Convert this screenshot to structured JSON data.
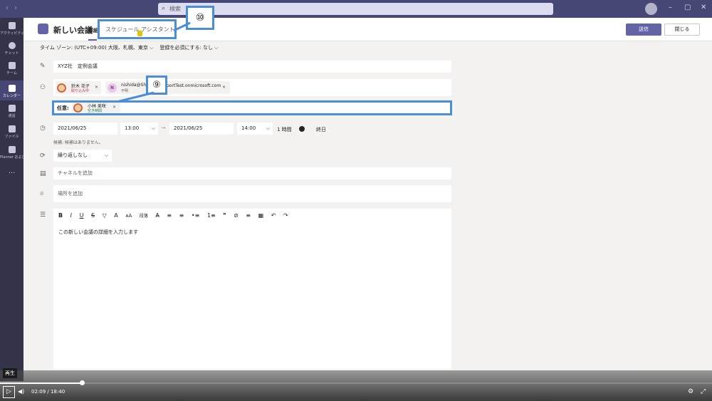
{
  "search": {
    "placeholder": "検索"
  },
  "rail": [
    {
      "label": "アクティビティ",
      "icon": "bell-icon"
    },
    {
      "label": "チャット",
      "icon": "chat-icon"
    },
    {
      "label": "チーム",
      "icon": "teams-icon"
    },
    {
      "label": "カレンダー",
      "icon": "calendar-icon"
    },
    {
      "label": "通話",
      "icon": "phone-icon"
    },
    {
      "label": "ファイル",
      "icon": "file-icon"
    },
    {
      "label": "Planner および...",
      "icon": "planner-icon"
    },
    {
      "label": "...",
      "icon": "more-icon"
    }
  ],
  "header": {
    "title": "新しい会議",
    "tab_details": "詳細",
    "tab_scheduling": "スケジュール アシスタント",
    "callout_10": "⑩",
    "send": "送信",
    "close": "閉じる"
  },
  "options": {
    "timezone": "タイム ゾーン: (UTC+09:00) 大阪、札幌、東京",
    "registration": "登録を必須にする: なし"
  },
  "form": {
    "title_value": "XYZ社　定例会議",
    "attendees": [
      {
        "name": "鈴木 花子",
        "status": "取り込み中"
      },
      {
        "initial": "N",
        "name": "nishida@Sh",
        "status": "不明",
        "suffix": "portTest.onmicrosoft.com"
      }
    ],
    "callout_9": "⑨",
    "optional_label": "任意:",
    "optional_attendee": {
      "name": "小林 美咲",
      "status": "空き時間"
    },
    "start_date": "2021/06/25",
    "start_time": "13:00",
    "end_date": "2021/06/25",
    "end_time": "14:00",
    "duration": "1 時間",
    "all_day": "終日",
    "suggestions": "候補: 候補はありません。",
    "repeat": "繰り返しなし",
    "channel_placeholder": "チャネルを追加",
    "location_placeholder": "場所を追加",
    "toolbar": [
      "B",
      "I",
      "U",
      "S",
      "▽",
      "A",
      "ᴀA",
      "段落",
      "A̶",
      "≡",
      "≡",
      "•≡",
      "1≡",
      "❞",
      "⊘",
      "≡",
      "▦",
      "↶",
      "↷"
    ],
    "body_text": "この新しい会議の詳細を入力します"
  },
  "video": {
    "play_tooltip": "再生",
    "time": "02:09 / 18:40",
    "progress": 0.115
  }
}
